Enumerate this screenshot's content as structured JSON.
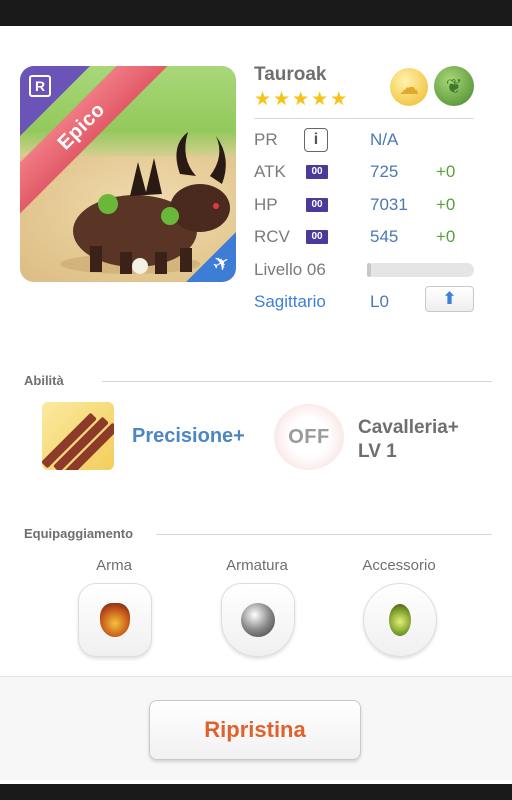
{
  "monster": {
    "name": "Tauroak",
    "rarity": "Epico",
    "rarity_badge": "R",
    "stars": 5,
    "elements": [
      "cloud-icon",
      "leaf-icon"
    ],
    "class_icon": "plane-icon"
  },
  "stats": {
    "pr": {
      "label": "PR",
      "value": "N/A"
    },
    "atk": {
      "label": "ATK",
      "badge": "00",
      "value": "725",
      "bonus": "+0"
    },
    "hp": {
      "label": "HP",
      "badge": "00",
      "value": "7031",
      "bonus": "+0"
    },
    "rcv": {
      "label": "RCV",
      "badge": "00",
      "value": "545",
      "bonus": "+0"
    }
  },
  "level": {
    "label": "Livello 06",
    "progress": 0.02
  },
  "constellation": {
    "label": "Sagittario",
    "level": "L0"
  },
  "abilities": {
    "title": "Abilità",
    "active_name": "Precisione+",
    "passive_state": "OFF",
    "passive_name_line1": "Cavalleria+",
    "passive_name_line2": "LV 1"
  },
  "equipment": {
    "title": "Equipaggiamento",
    "slots": [
      {
        "label": "Arma"
      },
      {
        "label": "Armatura"
      },
      {
        "label": "Accessorio"
      }
    ]
  },
  "actions": {
    "reset_label": "Ripristina"
  },
  "colors": {
    "accent_blue": "#4c78b5",
    "bonus_green": "#5aa13a",
    "reset_orange": "#e0612e",
    "rarity_red": "#e25a67"
  }
}
